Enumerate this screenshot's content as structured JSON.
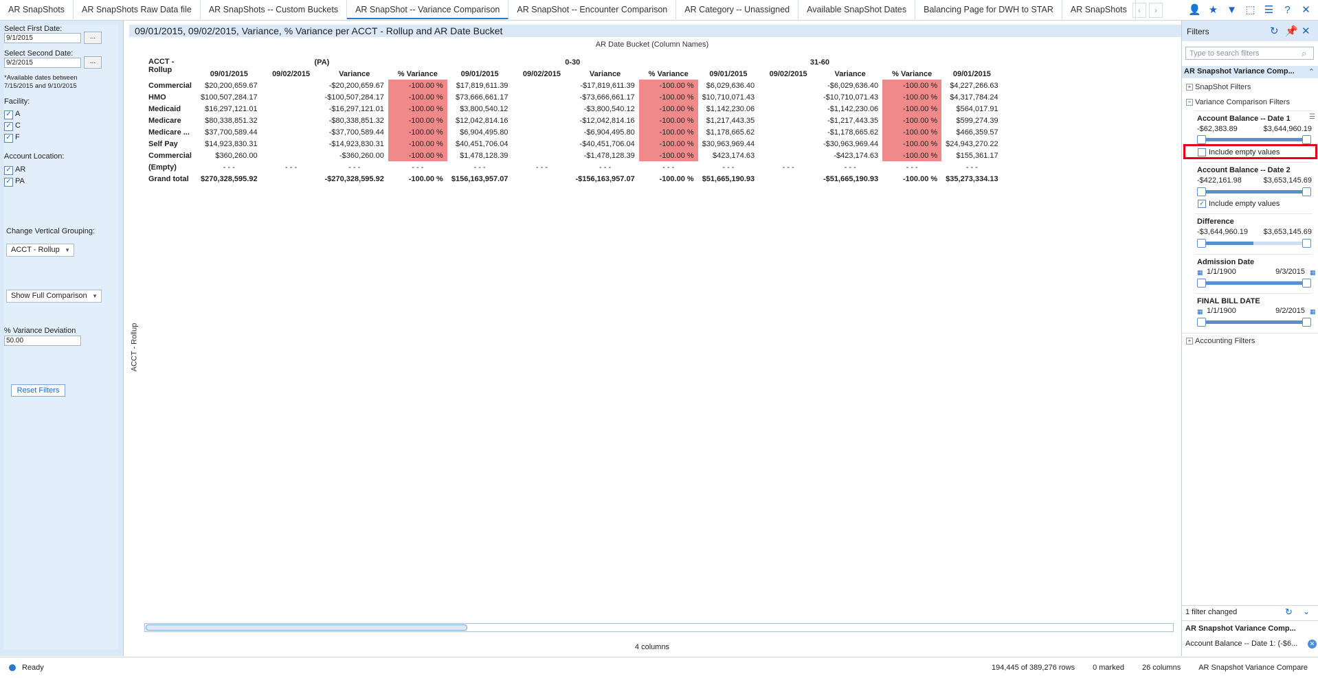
{
  "tabs": [
    {
      "label": "AR SnapShots"
    },
    {
      "label": "AR SnapShots Raw Data file"
    },
    {
      "label": "AR SnapShots -- Custom Buckets"
    },
    {
      "label": "AR SnapShot -- Variance Comparison",
      "active": true
    },
    {
      "label": "AR SnapShot -- Encounter Comparison"
    },
    {
      "label": "AR Category -- Unassigned"
    },
    {
      "label": "Available SnapShot Dates"
    },
    {
      "label": "Balancing Page for DWH to STAR"
    },
    {
      "label": "AR SnapShots"
    }
  ],
  "toolbar_icons": [
    "user-icon",
    "bookmark-icon",
    "filter-icon",
    "select-icon",
    "menu-icon",
    "help-icon",
    "close-icon"
  ],
  "left": {
    "first_date_label": "Select First Date:",
    "first_date_value": "9/1/2015",
    "second_date_label": "Select Second Date:",
    "second_date_value": "9/2/2015",
    "picker_label": "...",
    "available_note_1": "*Available dates between",
    "available_note_2": "7/15/2015 and 9/10/2015",
    "facility_label": "Facility:",
    "facilities": [
      "A",
      "C",
      "F"
    ],
    "location_label": "Account Location:",
    "locations": [
      "AR",
      "PA"
    ],
    "vertical_label": "Change Vertical Grouping:",
    "vertical_value": "ACCT - Rollup",
    "comparison_value": "Show Full Comparison",
    "variance_label": "% Variance Deviation",
    "variance_value": "50.00",
    "reset_label": "Reset Filters"
  },
  "main": {
    "title": "09/01/2015, 09/02/2015, Variance, % Variance per ACCT - Rollup and AR Date Bucket",
    "column_axis": "AR Date Bucket  (Column Names)",
    "row_axis": "ACCT - Rollup",
    "row_header": "ACCT - Rollup",
    "buckets": [
      "(PA)",
      "0-30",
      "31-60"
    ],
    "subheaders": [
      "09/01/2015",
      "09/02/2015",
      "Variance",
      "% Variance"
    ],
    "last_subheader": "09/01/2015",
    "rows": [
      {
        "name": "Commercial",
        "cells": [
          "$20,200,659.67",
          "",
          "-$20,200,659.67",
          "-100.00 %",
          "$17,819,611.39",
          "",
          "-$17,819,611.39",
          "-100.00 %",
          "$6,029,636.40",
          "",
          "-$6,029,636.40",
          "-100.00 %",
          "$4,227,266.63"
        ]
      },
      {
        "name": "HMO",
        "cells": [
          "$100,507,284.17",
          "",
          "-$100,507,284.17",
          "-100.00 %",
          "$73,666,661.17",
          "",
          "-$73,666,661.17",
          "-100.00 %",
          "$10,710,071.43",
          "",
          "-$10,710,071.43",
          "-100.00 %",
          "$4,317,784.24"
        ]
      },
      {
        "name": "Medicaid",
        "cells": [
          "$16,297,121.01",
          "",
          "-$16,297,121.01",
          "-100.00 %",
          "$3,800,540.12",
          "",
          "-$3,800,540.12",
          "-100.00 %",
          "$1,142,230.06",
          "",
          "-$1,142,230.06",
          "-100.00 %",
          "$564,017.91"
        ]
      },
      {
        "name": "Medicare",
        "cells": [
          "$80,338,851.32",
          "",
          "-$80,338,851.32",
          "-100.00 %",
          "$12,042,814.16",
          "",
          "-$12,042,814.16",
          "-100.00 %",
          "$1,217,443.35",
          "",
          "-$1,217,443.35",
          "-100.00 %",
          "$599,274.39"
        ]
      },
      {
        "name": "Medicare ...",
        "cells": [
          "$37,700,589.44",
          "",
          "-$37,700,589.44",
          "-100.00 %",
          "$6,904,495.80",
          "",
          "-$6,904,495.80",
          "-100.00 %",
          "$1,178,665.62",
          "",
          "-$1,178,665.62",
          "-100.00 %",
          "$466,359.57"
        ]
      },
      {
        "name": "Self Pay",
        "cells": [
          "$14,923,830.31",
          "",
          "-$14,923,830.31",
          "-100.00 %",
          "$40,451,706.04",
          "",
          "-$40,451,706.04",
          "-100.00 %",
          "$30,963,969.44",
          "",
          "-$30,963,969.44",
          "-100.00 %",
          "$24,943,270.22"
        ]
      },
      {
        "name": "Commercial",
        "cells": [
          "$360,260.00",
          "",
          "-$360,260.00",
          "-100.00 %",
          "$1,478,128.39",
          "",
          "-$1,478,128.39",
          "-100.00 %",
          "$423,174.63",
          "",
          "-$423,174.63",
          "-100.00 %",
          "$155,361.17"
        ]
      },
      {
        "name": "(Empty)",
        "cells": [
          "- - -",
          "- - -",
          "- - -",
          "- - -",
          "- - -",
          "- - -",
          "- - -",
          "- - -",
          "- - -",
          "- - -",
          "- - -",
          "- - -",
          "- - -"
        ]
      }
    ],
    "grand_total": {
      "name": "Grand total",
      "cells": [
        "$270,328,595.92",
        "",
        "-$270,328,595.92",
        "-100.00 %",
        "$156,163,957.07",
        "",
        "-$156,163,957.07",
        "-100.00 %",
        "$51,665,190.93",
        "",
        "-$51,665,190.93",
        "-100.00 %",
        "$35,273,334.13"
      ]
    },
    "column_count": "4 columns"
  },
  "filters": {
    "title": "Filters",
    "search_placeholder": "Type to search filters",
    "section": "AR Snapshot Variance Comp...",
    "group_snapshot": "SnapShot Filters",
    "group_variance": "Variance Comparison Filters",
    "group_accounting": "Accounting Filters",
    "acct_bal_1": {
      "name": "Account Balance -- Date 1",
      "min": "-$62,383.89",
      "max": "$3,644,960.19",
      "include": "Include empty values",
      "checked": false
    },
    "acct_bal_2": {
      "name": "Account Balance -- Date 2",
      "min": "-$422,161.98",
      "max": "$3,653,145.69",
      "include": "Include empty values",
      "checked": true
    },
    "difference": {
      "name": "Difference",
      "min": "-$3,644,960.19",
      "max": "$3,653,145.69"
    },
    "admission": {
      "name": "Admission Date",
      "min": "1/1/1900",
      "max": "9/3/2015"
    },
    "final_bill": {
      "name": "FINAL BILL DATE",
      "min": "1/1/1900",
      "max": "9/2/2015"
    },
    "changed": "1 filter changed",
    "bottom_title": "AR Snapshot Variance Comp...",
    "bottom_item": "Account Balance -- Date 1: (-$6..."
  },
  "status": {
    "text": "Ready",
    "rows": "194,445 of 389,276 rows",
    "marked": "0 marked",
    "columns": "26 columns",
    "page": "AR Snapshot Variance Compare"
  },
  "colors": {
    "accent": "#2b79c9",
    "negative_cell": "#f08a8a",
    "panel": "#dbe8f7",
    "highlight": "#e0001a"
  }
}
